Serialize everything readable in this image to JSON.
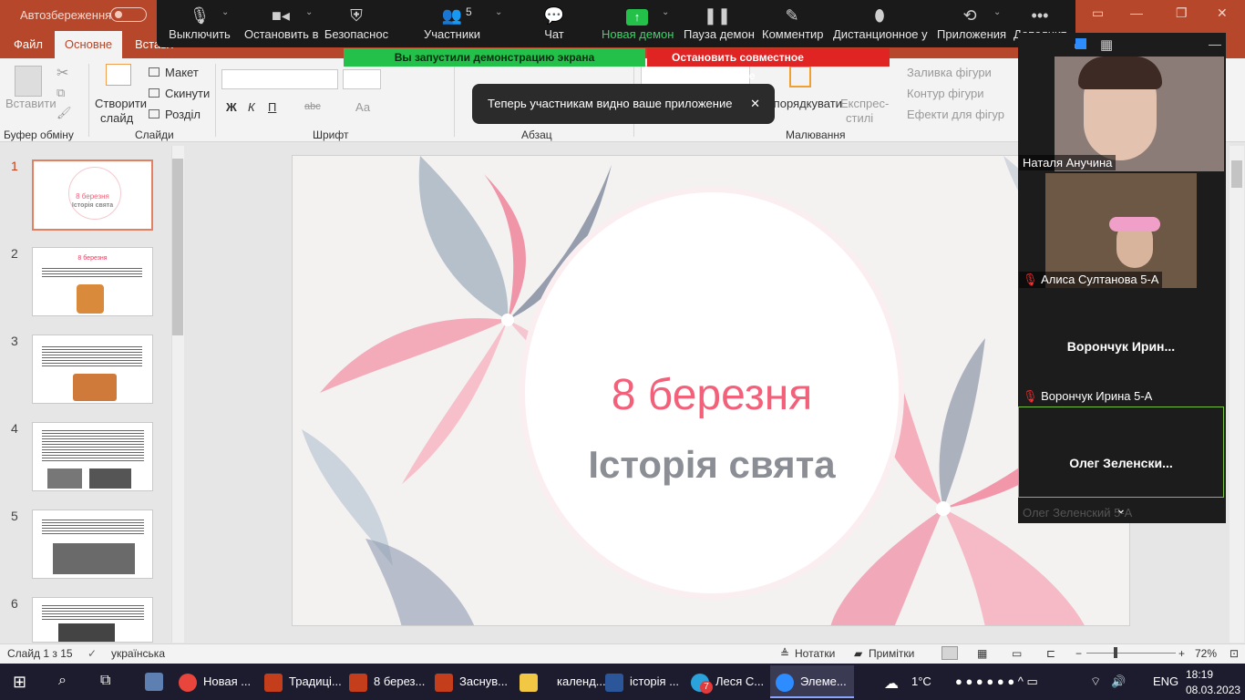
{
  "titlebar": {
    "autosave_label": "Автозбереження"
  },
  "ribbon": {
    "tabs": [
      "Файл",
      "Основне",
      "Вставл"
    ],
    "active_tab": "Основне",
    "clipboard": {
      "paste": "Вставити",
      "group": "Буфер обміну"
    },
    "slides": {
      "new_slide": "Створити",
      "new_slide2": "слайд",
      "layout": "Макет",
      "reset": "Скинути",
      "section": "Розділ",
      "group": "Слайди"
    },
    "font": {
      "group": "Шрифт",
      "bold": "Ж",
      "italic": "К",
      "underline": "П",
      "strike": "abc",
      "size_label": "Аа"
    },
    "paragraph": {
      "group": "Абзац"
    },
    "drawing": {
      "arrange": "Упорядкувати",
      "styles1": "Експрес-",
      "styles2": "стилі",
      "fill": "Заливка фігури",
      "outline": "Контур фігури",
      "effects": "Ефекти для фігур",
      "group": "Малювання"
    }
  },
  "zoom_toolbar": {
    "items": [
      {
        "label": "Выключить",
        "icon": "microphone-icon"
      },
      {
        "label": "Остановить в",
        "icon": "video-camera-icon"
      },
      {
        "label": "Безопаснос",
        "icon": "shield-icon"
      },
      {
        "label": "Участники",
        "icon": "participants-icon",
        "count": "5"
      },
      {
        "label": "Чат",
        "icon": "chat-icon"
      },
      {
        "label": "Новая демон",
        "icon": "share-up-icon"
      },
      {
        "label": "Пауза демон",
        "icon": "pause-icon"
      },
      {
        "label": "Комментир",
        "icon": "pen-icon"
      },
      {
        "label": "Дистанционное у",
        "icon": "mouse-icon"
      },
      {
        "label": "Приложения",
        "icon": "apps-icon"
      },
      {
        "label": "Дополнит",
        "icon": "more-icon"
      }
    ],
    "sharing_banner": "Вы запустили демонстрацию экрана",
    "stop_sharing": "Остановить совместное использование",
    "toast": "Теперь участникам видно ваше приложение"
  },
  "slide": {
    "title": "8 березня",
    "subtitle": "Історія свята"
  },
  "thumbnails": [
    {
      "num": "1",
      "title": "8 березня",
      "sub": "Історія свята"
    },
    {
      "num": "2",
      "title": "8 березня"
    },
    {
      "num": "3"
    },
    {
      "num": "4"
    },
    {
      "num": "5"
    },
    {
      "num": "6"
    }
  ],
  "gallery": {
    "p1": "Наталя Анучина",
    "p2": "Алиса Султанова 5-А",
    "p3_big": "Ворончук  Ирин...",
    "p3": "Ворончук Ирина 5-А",
    "p4_big": "Олег  Зеленски...",
    "p4": "Олег Зеленский 5-А"
  },
  "statusbar": {
    "slide_info": "Слайд 1 з 15",
    "language": "українська",
    "notes": "Нотатки",
    "comments": "Примітки",
    "zoom": "72%"
  },
  "taskbar": {
    "apps": [
      {
        "label": "Новая ...",
        "icon": "chrome-icon",
        "color": "#e8453c"
      },
      {
        "label": "Традиці...",
        "icon": "powerpoint-icon",
        "color": "#c43e1c"
      },
      {
        "label": "8 берез...",
        "icon": "powerpoint-icon",
        "color": "#c43e1c"
      },
      {
        "label": "Заснув...",
        "icon": "powerpoint-icon",
        "color": "#c43e1c"
      },
      {
        "label": "календ...",
        "icon": "folder-icon",
        "color": "#f2c744"
      },
      {
        "label": "історія ...",
        "icon": "word-icon",
        "color": "#2b579a"
      },
      {
        "label": "Леся С...",
        "icon": "telegram-icon",
        "color": "#2aa3dd"
      },
      {
        "label": "Элеме...",
        "icon": "zoom-icon",
        "color": "#2d8cff"
      }
    ],
    "weather": "1°C",
    "lang": "ENG",
    "time": "18:19",
    "date": "08.03.2023",
    "badge": "7"
  }
}
